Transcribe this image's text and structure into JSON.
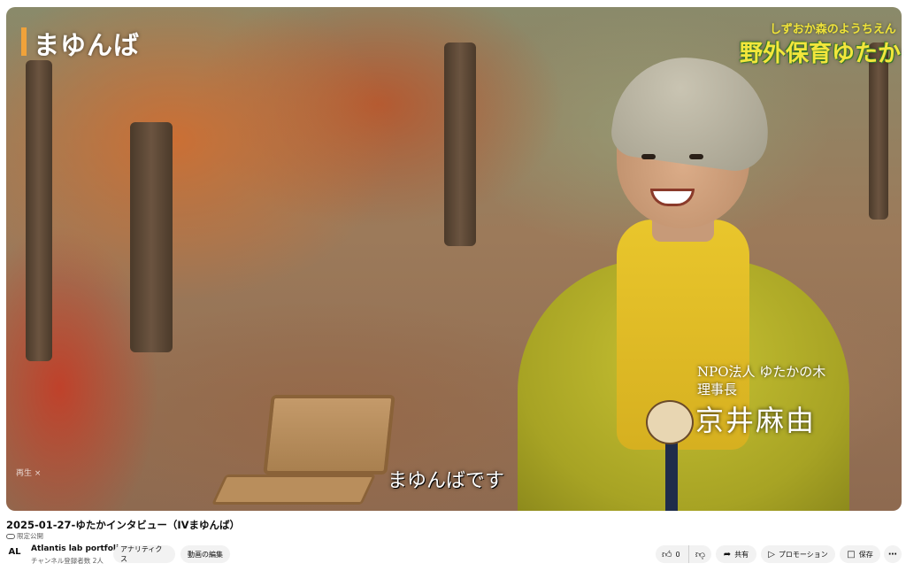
{
  "video": {
    "overlay_title": "まゆんば",
    "logo_top": "しずおか森のようちえん",
    "logo_main": "野外保育ゆたか",
    "caption_org": "NPO法人 ゆたかの木",
    "caption_role": "理事長",
    "caption_name": "京井麻由",
    "subtitle": "まゆんばです",
    "corner_label": "再生 ×"
  },
  "meta": {
    "title": "2025-01-27-ゆたかインタビュー（IVまゆんば）",
    "privacy": "限定公開"
  },
  "channel": {
    "avatar_text": "AL",
    "name": "Atlantis lab portfolio",
    "subscribers": "チャンネル登録者数 2人"
  },
  "actions": {
    "analytics": "アナリティクス",
    "edit_video": "動画の編集",
    "like_count": "0",
    "share": "共有",
    "promotion": "プロモーション",
    "save": "保存"
  },
  "icons": {
    "like": "thumbs-up-icon",
    "dislike": "thumbs-down-icon",
    "share": "share-arrow-icon",
    "promotion": "megaphone-icon",
    "save": "bookmark-icon",
    "more": "more-dots-icon"
  },
  "colors": {
    "accent_bar": "#f0a23a",
    "button_bg": "#f2f2f2"
  }
}
